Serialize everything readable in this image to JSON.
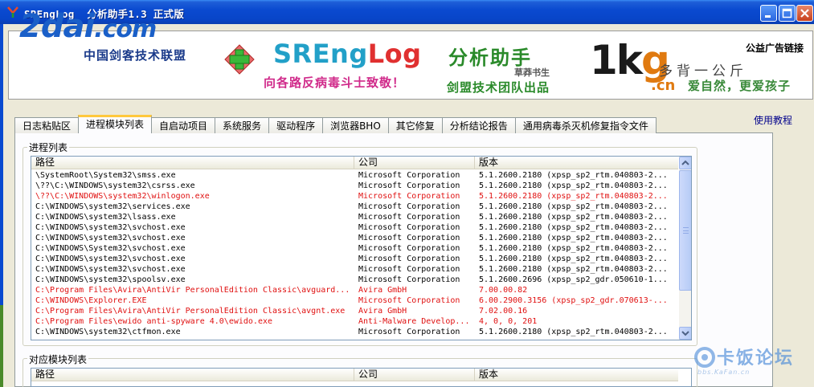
{
  "window": {
    "title": "SREngLog  分析助手1.3 正式版"
  },
  "banner": {
    "left_logo_text": "2dai",
    "left_logo_com": ".com",
    "left_logo_sub": "中国剑客技术联盟",
    "product_name_a": "SREng",
    "product_name_b": "Log",
    "product_subtitle": "分析助手",
    "product_author": "草莽书生",
    "slogan": "向各路反病毒斗士致敬！",
    "team": "剑盟技术团队出品",
    "right_logo_1k": "1k",
    "right_logo_g": "g",
    "right_logo_cn": ".cn",
    "right_tagline_1": "多背一公斤",
    "right_tagline_2": "爱自然，更爱孩子",
    "ad_link": "公益广告链接"
  },
  "tabs": [
    {
      "label": "日志粘贴区",
      "active": false
    },
    {
      "label": "进程模块列表",
      "active": true
    },
    {
      "label": "自启动项目",
      "active": false
    },
    {
      "label": "系统服务",
      "active": false
    },
    {
      "label": "驱动程序",
      "active": false
    },
    {
      "label": "浏览器BHO",
      "active": false
    },
    {
      "label": "其它修复",
      "active": false
    },
    {
      "label": "分析结论报告",
      "active": false
    },
    {
      "label": "通用病毒杀灭机修复指令文件",
      "active": false
    }
  ],
  "help_link": "使用教程",
  "process_list": {
    "group_label": "进程列表",
    "columns": {
      "path": "路径",
      "company": "公司",
      "version": "版本"
    },
    "rows": [
      {
        "path": "\\SystemRoot\\System32\\smss.exe",
        "company": "Microsoft Corporation",
        "version": "5.1.2600.2180 (xpsp_sp2_rtm.040803-2...",
        "flag": "normal"
      },
      {
        "path": "\\??\\C:\\WINDOWS\\system32\\csrss.exe",
        "company": "Microsoft Corporation",
        "version": "5.1.2600.2180 (xpsp_sp2_rtm.040803-2...",
        "flag": "normal"
      },
      {
        "path": "\\??\\C:\\WINDOWS\\system32\\winlogon.exe",
        "company": "Microsoft Corporation",
        "version": "5.1.2600.2180 (xpsp_sp2_rtm.040803-2...",
        "flag": "red"
      },
      {
        "path": "C:\\WINDOWS\\system32\\services.exe",
        "company": "Microsoft Corporation",
        "version": "5.1.2600.2180 (xpsp_sp2_rtm.040803-2...",
        "flag": "normal"
      },
      {
        "path": "C:\\WINDOWS\\system32\\lsass.exe",
        "company": "Microsoft Corporation",
        "version": "5.1.2600.2180 (xpsp_sp2_rtm.040803-2...",
        "flag": "normal"
      },
      {
        "path": "C:\\WINDOWS\\system32\\svchost.exe",
        "company": "Microsoft Corporation",
        "version": "5.1.2600.2180 (xpsp_sp2_rtm.040803-2...",
        "flag": "normal"
      },
      {
        "path": "C:\\WINDOWS\\system32\\svchost.exe",
        "company": "Microsoft Corporation",
        "version": "5.1.2600.2180 (xpsp_sp2_rtm.040803-2...",
        "flag": "normal"
      },
      {
        "path": "C:\\WINDOWS\\System32\\svchost.exe",
        "company": "Microsoft Corporation",
        "version": "5.1.2600.2180 (xpsp_sp2_rtm.040803-2...",
        "flag": "normal"
      },
      {
        "path": "C:\\WINDOWS\\system32\\svchost.exe",
        "company": "Microsoft Corporation",
        "version": "5.1.2600.2180 (xpsp_sp2_rtm.040803-2...",
        "flag": "normal"
      },
      {
        "path": "C:\\WINDOWS\\system32\\svchost.exe",
        "company": "Microsoft Corporation",
        "version": "5.1.2600.2180 (xpsp_sp2_rtm.040803-2...",
        "flag": "normal"
      },
      {
        "path": "C:\\WINDOWS\\system32\\spoolsv.exe",
        "company": "Microsoft Corporation",
        "version": "5.1.2600.2696 (xpsp_sp2_gdr.050610-1...",
        "flag": "normal"
      },
      {
        "path": "C:\\Program Files\\Avira\\AntiVir PersonalEdition Classic\\avguard...",
        "company": "Avira GmbH",
        "version": "7.00.00.82",
        "flag": "red"
      },
      {
        "path": "C:\\WINDOWS\\Explorer.EXE",
        "company": "Microsoft Corporation",
        "version": "6.00.2900.3156 (xpsp_sp2_gdr.070613-...",
        "flag": "red"
      },
      {
        "path": "C:\\Program Files\\Avira\\AntiVir PersonalEdition Classic\\avgnt.exe",
        "company": "Avira GmbH",
        "version": "7.02.00.16",
        "flag": "red"
      },
      {
        "path": "C:\\Program Files\\ewido anti-spyware 4.0\\ewido.exe",
        "company": "Anti-Malware Develop...",
        "version": "4, 0, 0, 201",
        "flag": "red"
      },
      {
        "path": "C:\\WINDOWS\\system32\\ctfmon.exe",
        "company": "Microsoft Corporation",
        "version": "5.1.2600.2180 (xpsp_sp2_rtm.040803-2...",
        "flag": "normal"
      }
    ]
  },
  "module_list": {
    "group_label": "对应模块列表",
    "columns": {
      "path": "路径",
      "company": "公司",
      "version": "版本"
    }
  },
  "watermark": {
    "text": "卡饭论坛",
    "sub": "bbs.KaFan.cn"
  },
  "colors": {
    "titlebar": "#0a4ad0",
    "highlight_row": "#e01010",
    "tab_active_accent": "#ffc83c"
  }
}
